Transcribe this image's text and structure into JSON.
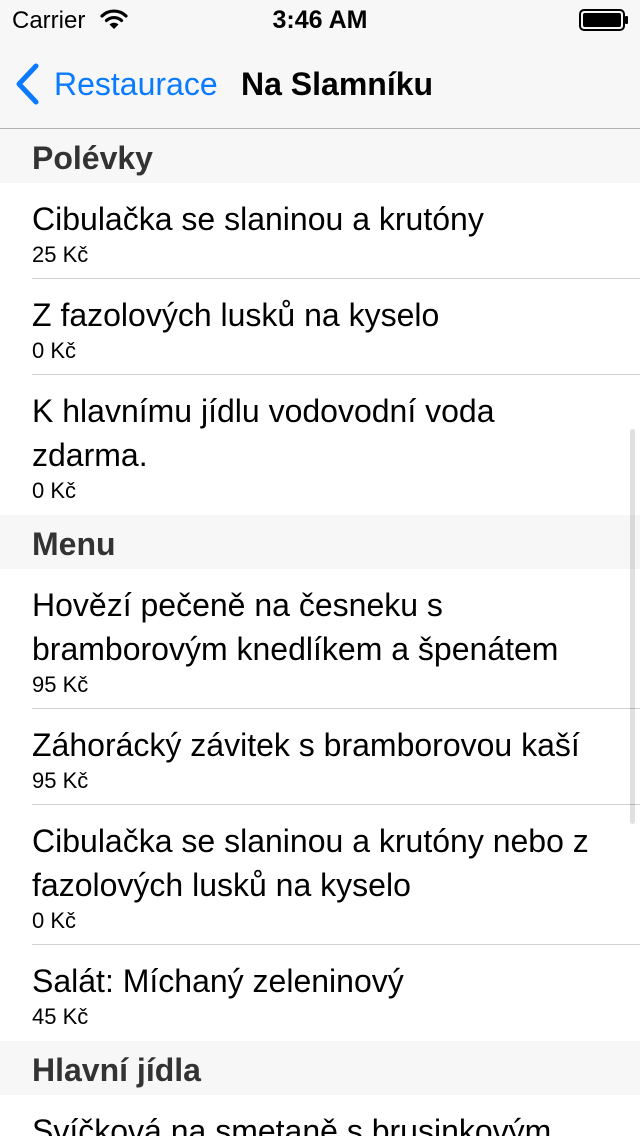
{
  "status_bar": {
    "carrier": "Carrier",
    "time": "3:46 AM"
  },
  "nav": {
    "back_label": "Restaurace",
    "title": "Na Slamníku"
  },
  "colors": {
    "tint": "#0a7aff",
    "header_bg": "#f7f7f7",
    "separator": "#d1d1d1"
  },
  "sections": [
    {
      "title": "Polévky",
      "items": [
        {
          "name": "Cibulačka se slaninou a krutóny",
          "price": "25 Kč"
        },
        {
          "name": "Z fazolových lusků na kyselo",
          "price": "0 Kč"
        },
        {
          "name": "K hlavnímu jídlu vodovodní voda zdarma.",
          "price": "0 Kč"
        }
      ]
    },
    {
      "title": "Menu",
      "items": [
        {
          "name": "Hovězí pečeně na česneku s bramborovým knedlíkem a špenátem",
          "price": "95 Kč"
        },
        {
          "name": "Záhorácký závitek s bramborovou kaší",
          "price": "95 Kč"
        },
        {
          "name": "Cibulačka se slaninou a krutóny nebo z fazolových lusků na kyselo",
          "price": "0 Kč"
        },
        {
          "name": "Salát: Míchaný zeleninový",
          "price": "45 Kč"
        }
      ]
    },
    {
      "title": "Hlavní jídla",
      "items": [
        {
          "name": "Svíčková na smetaně s brusinkovým",
          "price": ""
        }
      ]
    }
  ]
}
